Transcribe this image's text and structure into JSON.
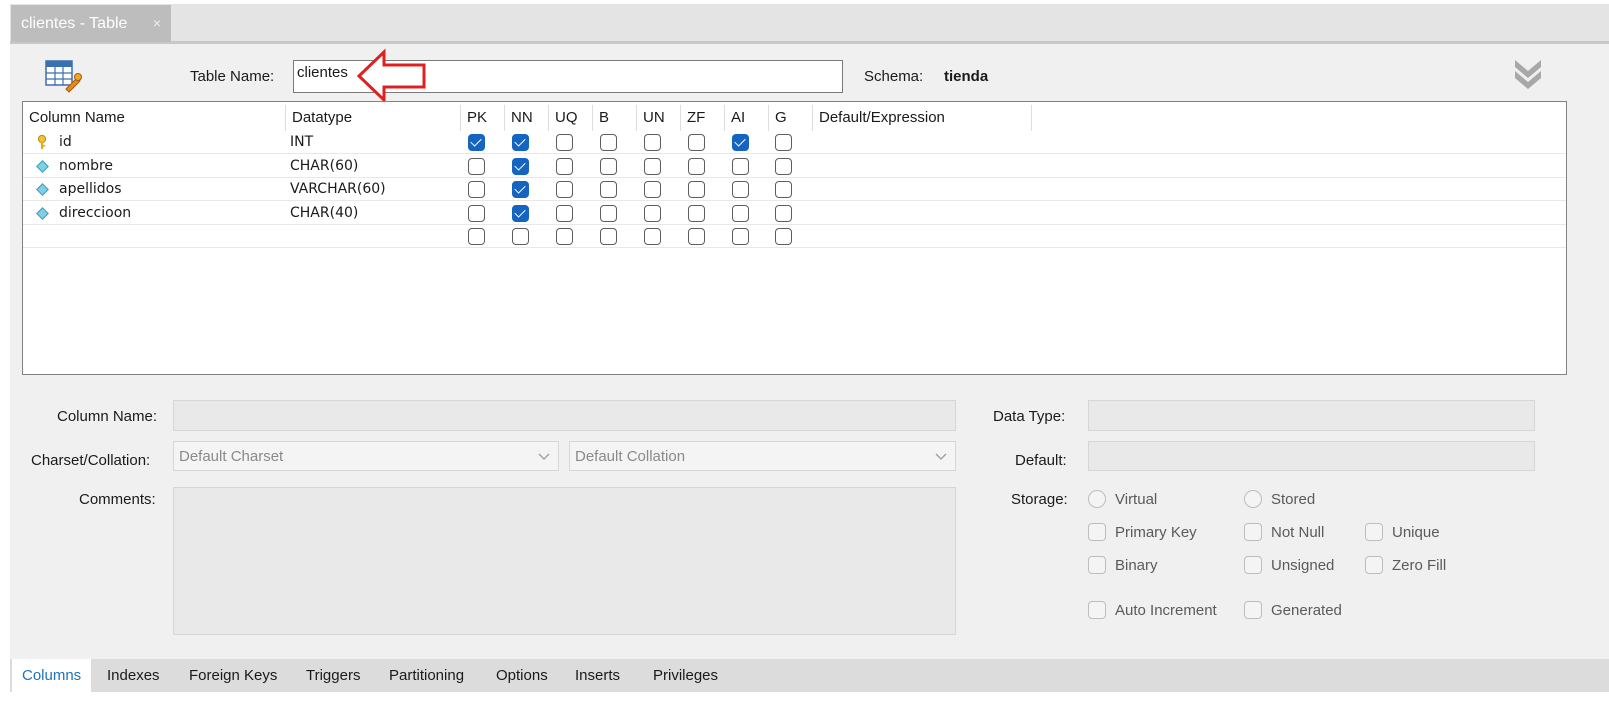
{
  "tab": {
    "title": "clientes - Table",
    "close": "×"
  },
  "header": {
    "table_name_label": "Table Name:",
    "table_name_value": "clientes",
    "schema_label": "Schema:",
    "schema_value": "tienda"
  },
  "grid": {
    "headers": [
      "Column Name",
      "Datatype",
      "PK",
      "NN",
      "UQ",
      "B",
      "UN",
      "ZF",
      "AI",
      "G",
      "Default/Expression"
    ],
    "rows": [
      {
        "icon": "key-icon",
        "name": "id",
        "datatype": "INT",
        "flags": [
          true,
          true,
          false,
          false,
          false,
          false,
          true,
          false
        ]
      },
      {
        "icon": "column-diamond-icon",
        "name": "nombre",
        "datatype": "CHAR(60)",
        "flags": [
          false,
          true,
          false,
          false,
          false,
          false,
          false,
          false
        ]
      },
      {
        "icon": "column-diamond-icon",
        "name": "apellidos",
        "datatype": "VARCHAR(60)",
        "flags": [
          false,
          true,
          false,
          false,
          false,
          false,
          false,
          false
        ]
      },
      {
        "icon": "column-diamond-icon",
        "name": "direccioon",
        "datatype": "CHAR(40)",
        "flags": [
          false,
          true,
          false,
          false,
          false,
          false,
          false,
          false
        ]
      },
      {
        "icon": "",
        "name": "",
        "datatype": "",
        "flags": [
          false,
          false,
          false,
          false,
          false,
          false,
          false,
          false
        ]
      }
    ]
  },
  "details": {
    "column_name_label": "Column Name:",
    "charset_label": "Charset/Collation:",
    "charset_value": "Default Charset",
    "collation_value": "Default Collation",
    "comments_label": "Comments:",
    "data_type_label": "Data Type:",
    "default_label": "Default:",
    "storage_label": "Storage:",
    "virtual": "Virtual",
    "stored": "Stored",
    "primary_key": "Primary Key",
    "not_null": "Not Null",
    "unique": "Unique",
    "binary": "Binary",
    "unsigned": "Unsigned",
    "zero_fill": "Zero Fill",
    "auto_increment": "Auto Increment",
    "generated": "Generated"
  },
  "bottom_tabs": [
    "Columns",
    "Indexes",
    "Foreign Keys",
    "Triggers",
    "Partitioning",
    "Options",
    "Inserts",
    "Privileges"
  ],
  "colors": {
    "accent": "#1564c0",
    "annotation_arrow": "#e02020",
    "active_tab_text": "#1e73be"
  }
}
